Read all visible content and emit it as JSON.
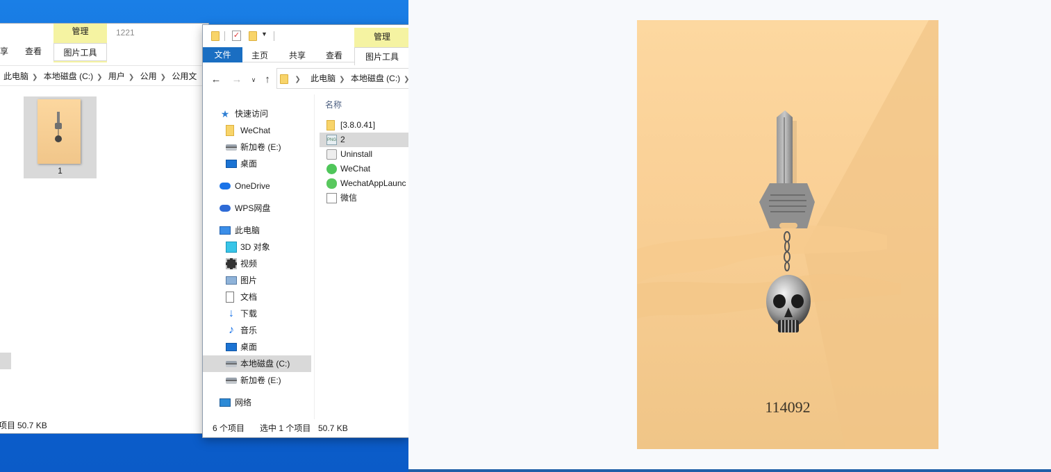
{
  "window1": {
    "tabs": {
      "share_partial": "享",
      "view": "查看"
    },
    "context_group": {
      "title": "管理",
      "tool": "图片工具"
    },
    "title_text": "1221",
    "breadcrumb": [
      "此电脑",
      "本地磁盘 (C:)",
      "用户",
      "公用",
      "公用文"
    ],
    "file": {
      "name": "1"
    },
    "status": {
      "items_partial": "项目",
      "size": "50.7 KB"
    }
  },
  "window2": {
    "tabs": {
      "file": "文件",
      "home": "主页",
      "share": "共享",
      "view": "查看"
    },
    "context_group": {
      "title": "管理",
      "tool": "图片工具"
    },
    "breadcrumb": [
      "此电脑",
      "本地磁盘 (C:)"
    ],
    "nav": [
      {
        "label": "快速访问",
        "icon": "star-icon"
      },
      {
        "label": "WeChat",
        "icon": "folder-icon"
      },
      {
        "label": "新加卷 (E:)",
        "icon": "drive-icon"
      },
      {
        "label": "桌面",
        "icon": "desktop-icon"
      },
      {
        "label": "OneDrive",
        "icon": "onedrive-icon"
      },
      {
        "label": "WPS网盘",
        "icon": "wps-cloud-icon"
      },
      {
        "label": "此电脑",
        "icon": "computer-icon"
      },
      {
        "label": "3D 对象",
        "icon": "cube-icon"
      },
      {
        "label": "视频",
        "icon": "film-icon"
      },
      {
        "label": "图片",
        "icon": "picture-icon"
      },
      {
        "label": "文档",
        "icon": "document-icon"
      },
      {
        "label": "下载",
        "icon": "download-icon"
      },
      {
        "label": "音乐",
        "icon": "music-icon"
      },
      {
        "label": "桌面",
        "icon": "desktop-icon"
      },
      {
        "label": "本地磁盘 (C:)",
        "icon": "drive-icon"
      },
      {
        "label": "新加卷 (E:)",
        "icon": "drive-icon"
      },
      {
        "label": "网络",
        "icon": "network-icon"
      }
    ],
    "column_name": "名称",
    "files": [
      {
        "name": "[3.8.0.41]",
        "icon": "folder-icon"
      },
      {
        "name": "2",
        "icon": "png-icon"
      },
      {
        "name": "Uninstall",
        "icon": "uninstall-icon"
      },
      {
        "name": "WeChat",
        "icon": "wechat-icon"
      },
      {
        "name": "WechatAppLaunc",
        "icon": "wechat-app-icon"
      },
      {
        "name": "微信",
        "icon": "weixin-shortcut-icon"
      }
    ],
    "status": {
      "count": "6 个项目",
      "selected": "选中 1 个项目",
      "size": "50.7 KB"
    }
  },
  "viewer": {
    "poster_code": "114092"
  }
}
